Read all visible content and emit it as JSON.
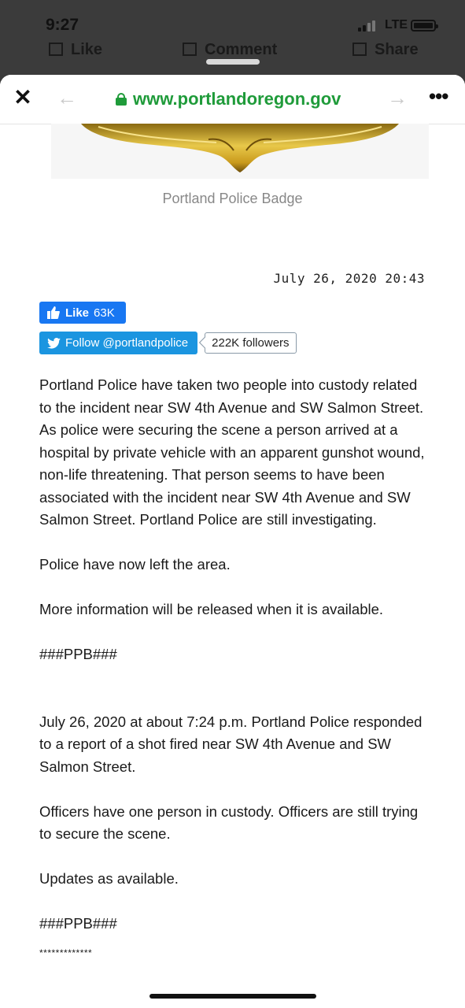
{
  "status_bar": {
    "time": "9:27",
    "network": "LTE"
  },
  "behind_sheet": {
    "like": "Like",
    "comment": "Comment",
    "share": "Share"
  },
  "browser": {
    "url": "www.portlandoregon.gov"
  },
  "page": {
    "image_caption": "Portland Police Badge",
    "dateline": "July 26, 2020 20:43",
    "facebook": {
      "label": "Like",
      "count": "63K"
    },
    "twitter": {
      "follow_label": "Follow @portlandpolice",
      "followers": "222K followers"
    },
    "paragraphs": [
      "Portland Police have taken two people into custody related to the incident near SW 4th Avenue and SW Salmon Street. As police were securing the scene a person arrived at a hospital by private vehicle with an apparent gunshot wound, non-life threatening. That person seems to have been associated with the incident near SW 4th Avenue and SW Salmon Street. Portland Police are still investigating.",
      "Police have now left the area.",
      "More information will be released when it is available.",
      "###PPB###",
      "July 26, 2020 at about 7:24 p.m. Portland Police responded to a report of a shot fired near SW 4th Avenue and SW Salmon Street.",
      "Officers have one person in custody. Officers are still trying to secure the scene.",
      "Updates as available.",
      "###PPB###",
      "*************"
    ]
  },
  "colors": {
    "url_green": "#1f9b3a",
    "facebook_blue": "#1877f2",
    "twitter_blue": "#1b95e0"
  },
  "icons": [
    "close-icon",
    "back-arrow-icon",
    "lock-icon",
    "forward-arrow-icon",
    "more-icon",
    "thumbs-up-icon",
    "twitter-bird-icon"
  ]
}
